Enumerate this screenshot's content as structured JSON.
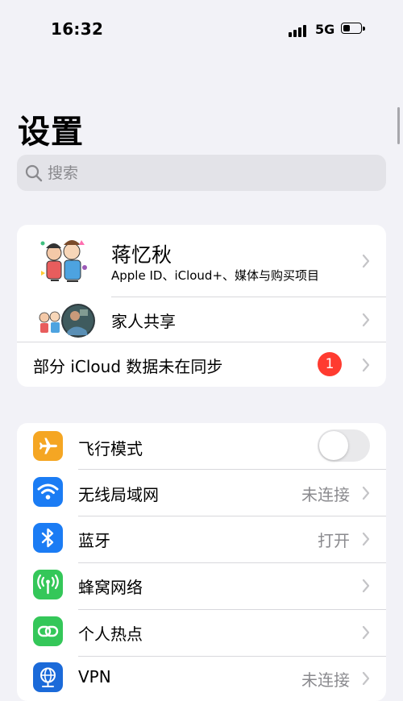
{
  "status_bar": {
    "time": "16:32",
    "network": "5G"
  },
  "page_title": "设置",
  "search": {
    "placeholder": "搜索"
  },
  "account": {
    "name": "蒋忆秋",
    "subtitle": "Apple ID、iCloud+、媒体与购买项目",
    "family_label": "家人共享",
    "icloud_sync_label": "部分 iCloud 数据未在同步",
    "icloud_badge": "1"
  },
  "settings": [
    {
      "label": "飞行模式",
      "icon": "airplane-icon",
      "color": "#f5a623",
      "toggle": false
    },
    {
      "label": "无线局域网",
      "value": "未连接",
      "icon": "wifi-icon",
      "color": "#1b7cf4"
    },
    {
      "label": "蓝牙",
      "value": "打开",
      "icon": "bluetooth-icon",
      "color": "#1b7cf4"
    },
    {
      "label": "蜂窝网络",
      "icon": "cellular-icon",
      "color": "#34c759"
    },
    {
      "label": "个人热点",
      "icon": "hotspot-icon",
      "color": "#34c759"
    },
    {
      "label": "VPN",
      "value": "未连接",
      "icon": "vpn-icon",
      "color": "#1b6ad9"
    }
  ],
  "colors": {
    "background": "#f2f2f7",
    "badge": "#ff3b30"
  }
}
